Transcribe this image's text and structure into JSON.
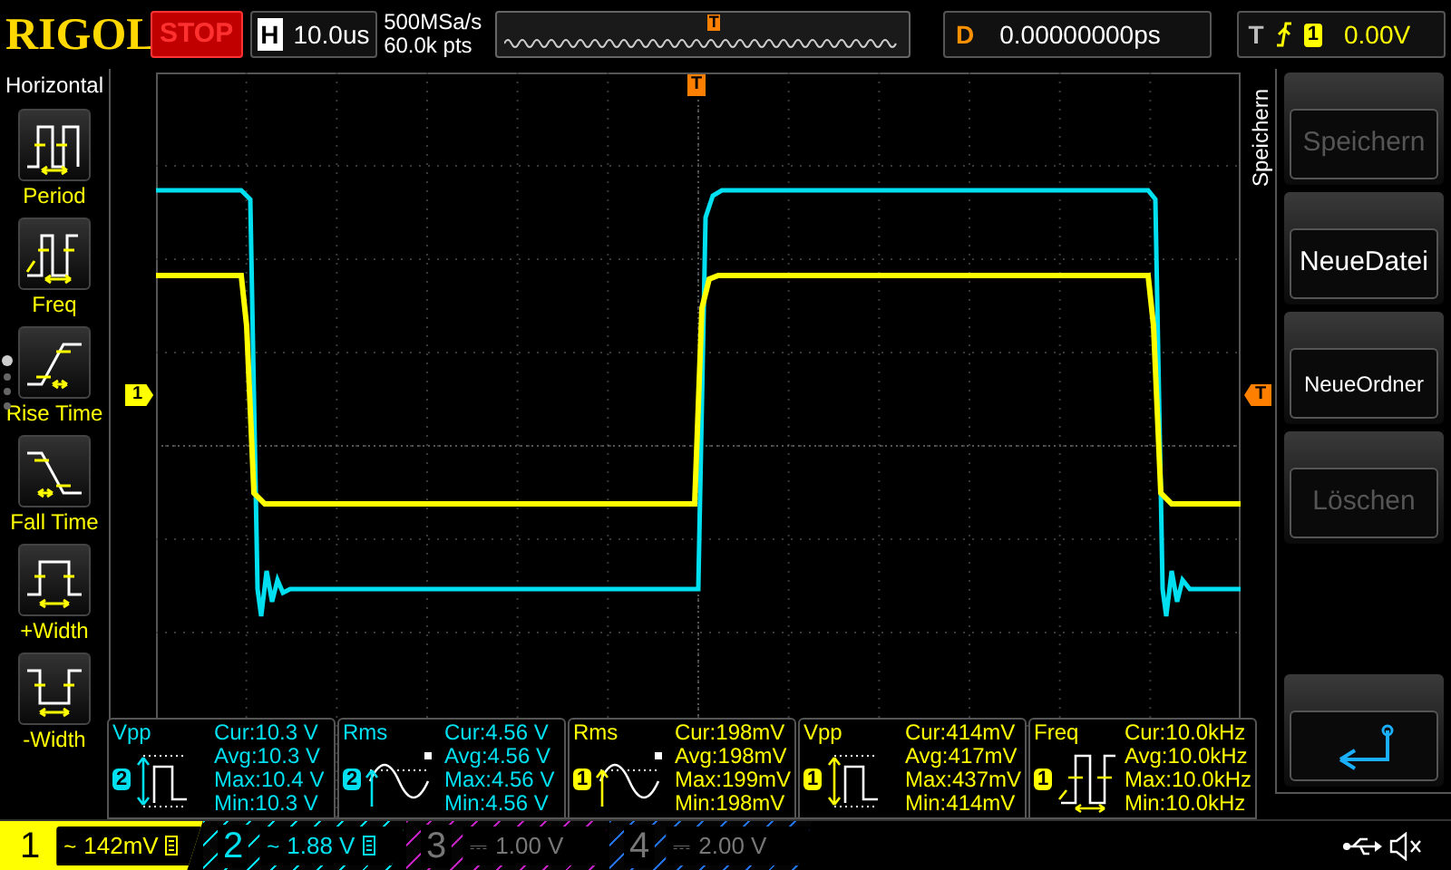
{
  "brand": "RIGOL",
  "run_state": "STOP",
  "horizontal": {
    "label": "H",
    "timebase": "10.0us",
    "sample_rate": "500MSa/s",
    "memory_depth": "60.0k pts"
  },
  "overview_trigger_marker": "T",
  "trigger_marker": "T",
  "delay": {
    "label": "D",
    "value": "0.00000000ps"
  },
  "trigger": {
    "label": "T",
    "source": "1",
    "level": "0.00V"
  },
  "left_menu": {
    "title": "Horizontal",
    "items": [
      {
        "label": "Period",
        "kind": "period"
      },
      {
        "label": "Freq",
        "kind": "freq"
      },
      {
        "label": "Rise Time",
        "kind": "rise"
      },
      {
        "label": "Fall Time",
        "kind": "fall"
      },
      {
        "label": "+Width",
        "kind": "pwidth"
      },
      {
        "label": "-Width",
        "kind": "nwidth"
      }
    ]
  },
  "page_dots": [
    {
      "selected": true
    },
    {
      "selected": false
    },
    {
      "selected": false
    },
    {
      "selected": false
    }
  ],
  "channel_marker": "1",
  "trigger_level_marker": "T",
  "right_menu": {
    "title": "Speichern",
    "items": [
      {
        "label": "Speichern",
        "disabled": true
      },
      {
        "label": "NeueDatei",
        "disabled": false
      },
      {
        "label": "NeueOrdner",
        "disabled": false
      },
      {
        "label": "Löschen",
        "disabled": true
      }
    ]
  },
  "measurements": [
    {
      "name": "Vpp",
      "channel": "2",
      "color": "#00e0f0",
      "kind": "vpp",
      "lines": [
        "Cur:10.3 V",
        "Avg:10.3 V",
        "Max:10.4 V",
        "Min:10.3 V"
      ]
    },
    {
      "name": "Rms",
      "channel": "2",
      "color": "#00e0f0",
      "kind": "rms",
      "lines": [
        "Cur:4.56 V",
        "Avg:4.56 V",
        "Max:4.56 V",
        "Min:4.56 V"
      ]
    },
    {
      "name": "Rms",
      "channel": "1",
      "color": "#ffff00",
      "kind": "rms",
      "lines": [
        "Cur:198mV",
        "Avg:198mV",
        "Max:199mV",
        "Min:198mV"
      ]
    },
    {
      "name": "Vpp",
      "channel": "1",
      "color": "#ffff00",
      "kind": "vpp",
      "lines": [
        "Cur:414mV",
        "Avg:417mV",
        "Max:437mV",
        "Min:414mV"
      ]
    },
    {
      "name": "Freq",
      "channel": "1",
      "color": "#ffff00",
      "kind": "freq",
      "lines": [
        "Cur:10.0kHz",
        "Avg:10.0kHz",
        "Max:10.0kHz",
        "Min:10.0kHz"
      ]
    }
  ],
  "channels": [
    {
      "number": "1",
      "coupling": "~",
      "scale": "142mV",
      "enabled": true,
      "selected": true,
      "color": "#ffff00"
    },
    {
      "number": "2",
      "coupling": "~",
      "scale": "1.88 V",
      "enabled": true,
      "selected": false,
      "color": "#00e0f0"
    },
    {
      "number": "3",
      "coupling": "⎓",
      "scale": "1.00 V",
      "enabled": false,
      "selected": false,
      "color": "#c020c0"
    },
    {
      "number": "4",
      "coupling": "⎓",
      "scale": "2.00 V",
      "enabled": false,
      "selected": false,
      "color": "#2070e0"
    }
  ]
}
